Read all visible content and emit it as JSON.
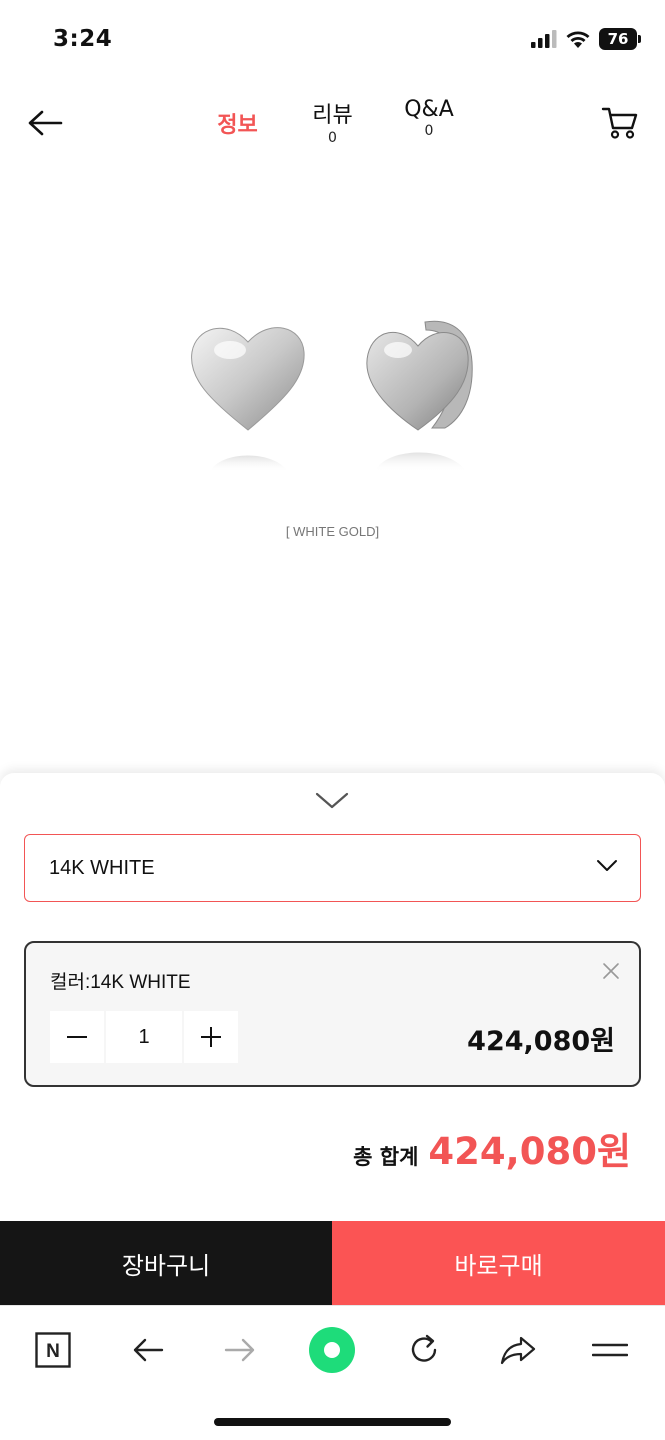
{
  "status": {
    "time": "3:24",
    "battery": "76"
  },
  "nav": {
    "tabs": [
      {
        "label": "정보"
      },
      {
        "label": "리뷰",
        "count": "0"
      },
      {
        "label": "Q&A",
        "count": "0"
      }
    ]
  },
  "product": {
    "image_caption": "[ WHITE GOLD]"
  },
  "option": {
    "selected": "14K WHITE"
  },
  "selected_item": {
    "name": "컬러:14K WHITE",
    "quantity": "1",
    "price": "424,080원"
  },
  "total": {
    "label": "총 합계",
    "value": "424,080원"
  },
  "actions": {
    "cart": "장바구니",
    "buy": "바로구매"
  },
  "browser": {
    "home_letter": "N"
  },
  "colors": {
    "accent": "#f25555",
    "buy": "#fb5454",
    "dark": "#151515",
    "green": "#1edc7a"
  }
}
